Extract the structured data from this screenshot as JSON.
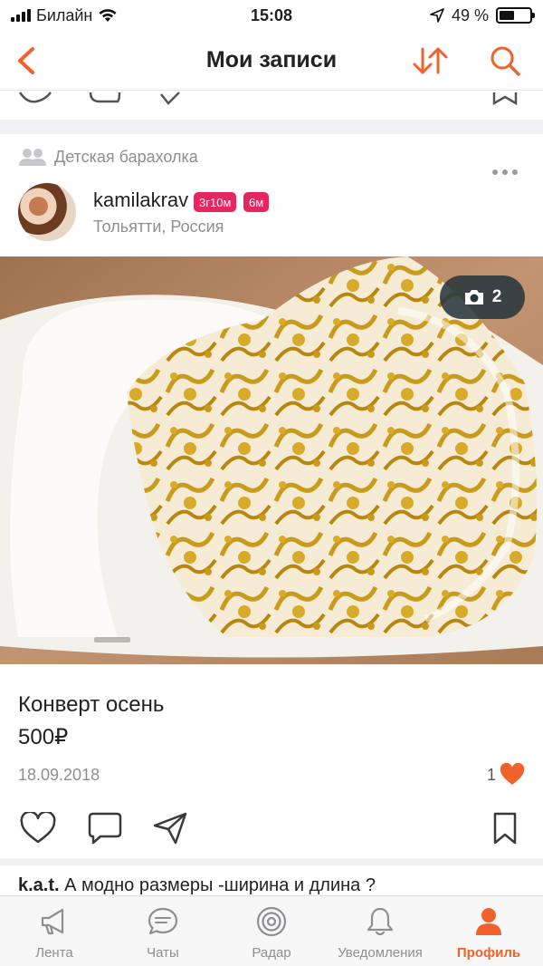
{
  "status_bar": {
    "carrier": "Билайн",
    "time": "15:08",
    "battery_percent": "49 %",
    "battery_level": 0.49
  },
  "nav": {
    "title": "Мои записи",
    "back_icon": "chevron-left-icon",
    "sort_icon": "sort-arrows-icon",
    "search_icon": "search-icon"
  },
  "post": {
    "group": "Детская барахолка",
    "username": "kamilakrav",
    "badges": [
      "3г10м",
      "6м"
    ],
    "location": "Тольятти, Россия",
    "photo_count": "2",
    "title": "Конверт осень",
    "price": "500₽",
    "date": "18.09.2018",
    "likes": "1"
  },
  "comment": {
    "author": "k.a.t.",
    "text": "А модно размеры -ширина и длина ?"
  },
  "tabs": [
    {
      "label": "Лента",
      "icon": "megaphone-icon",
      "active": false
    },
    {
      "label": "Чаты",
      "icon": "chat-bubble-icon",
      "active": false
    },
    {
      "label": "Радар",
      "icon": "radar-icon",
      "active": false
    },
    {
      "label": "Уведомления",
      "icon": "bell-icon",
      "active": false
    },
    {
      "label": "Профиль",
      "icon": "profile-icon",
      "active": true
    }
  ],
  "colors": {
    "accent": "#f1612c",
    "badge": "#e6265f",
    "secondary_text": "#8e8e93"
  }
}
